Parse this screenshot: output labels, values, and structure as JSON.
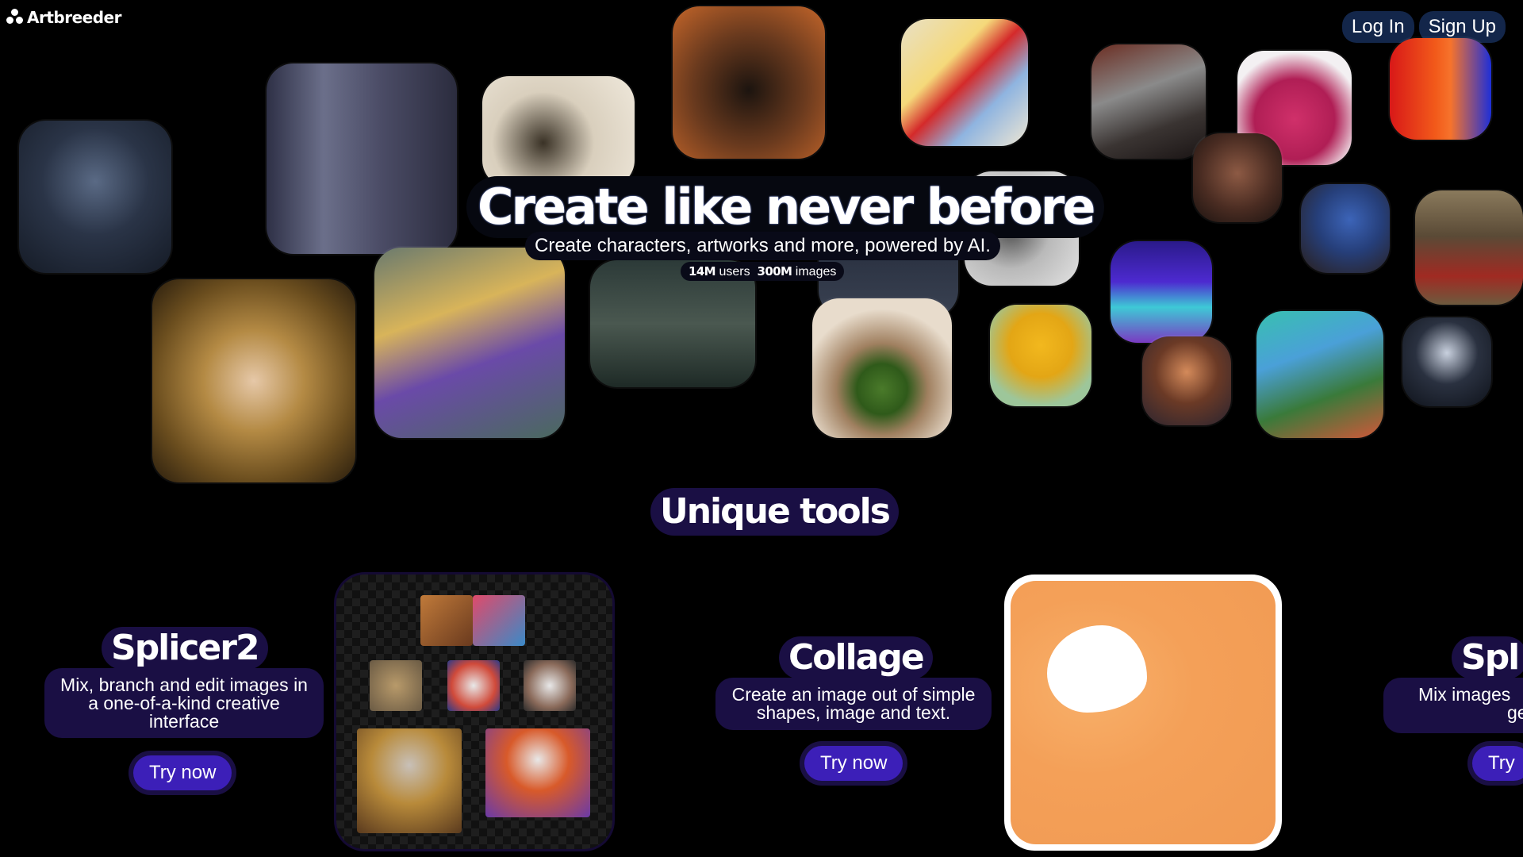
{
  "header": {
    "logo_text": "Artbreeder",
    "login_label": "Log In",
    "signup_label": "Sign Up"
  },
  "hero": {
    "title": "Create like never before",
    "subtitle": "Create characters, artworks and more, powered by AI.",
    "users_count": "14M",
    "users_label": "users",
    "images_count": "300M",
    "images_label": "images"
  },
  "tools_section": {
    "title": "Unique tools",
    "tools": [
      {
        "name": "Splicer2",
        "description": "Mix, branch and edit images in a one-of-a-kind creative interface",
        "button": "Try now"
      },
      {
        "name": "Collage",
        "description": "Create an image out of simple shapes, image and text.",
        "button": "Try now"
      },
      {
        "name": "Spl",
        "description_line1": "Mix images",
        "description_line2": "ge",
        "button": "Try"
      }
    ]
  },
  "colors": {
    "background": "#000000",
    "accent_purple": "#3c1fb8",
    "label_bg": "#1a0f44",
    "auth_bg": "#13264a",
    "collage_orange": "#f4a058"
  }
}
